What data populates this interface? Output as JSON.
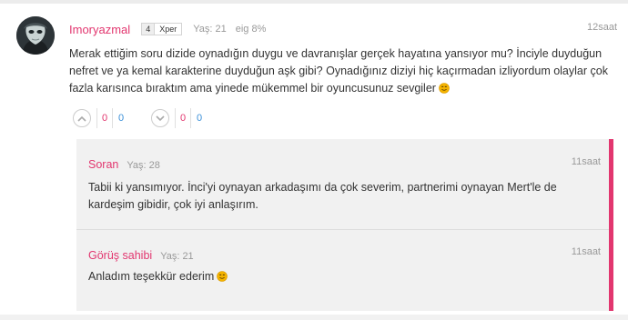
{
  "comment": {
    "username": "Imoryazmal",
    "xper_level": "4",
    "xper_label": "Xper",
    "age": "Yaş: 21",
    "eig": "eig 8%",
    "time": "12saat",
    "text": "Merak ettiğim soru dizide oynadığın duygu ve davranışlar gerçek hayatına yansıyor mu? İnciyle duyduğun nefret ve ya kemal karakterine duyduğun aşk gibi? Oynadığınız diziyi hiç kaçırmadan izliyordum olaylar çok fazla karısınca bıraktım ama yinede mükemmel bir oyuncusunuz sevgiler",
    "emoji": "smile-emoji",
    "upvote": {
      "pink": "0",
      "blue": "0"
    },
    "downvote": {
      "pink": "0",
      "blue": "0"
    }
  },
  "replies": [
    {
      "author": "Soran",
      "age": "Yaş: 28",
      "time": "11saat",
      "text": "Tabii ki yansımıyor. İnci'yi oynayan arkadaşımı da çok severim, partnerimi oynayan Mert'le de kardeşim gibidir, çok iyi anlaşırım."
    },
    {
      "author": "Görüş sahibi",
      "age": "Yaş: 21",
      "time": "11saat",
      "text": "Anladım teşekkür ederim",
      "emoji": "smile-emoji"
    }
  ],
  "colors": {
    "accent": "#e2366f",
    "blue": "#3a8fd8",
    "reply_bg": "#f1f1f1",
    "meta": "#999999",
    "emoji": "#f5b400"
  }
}
